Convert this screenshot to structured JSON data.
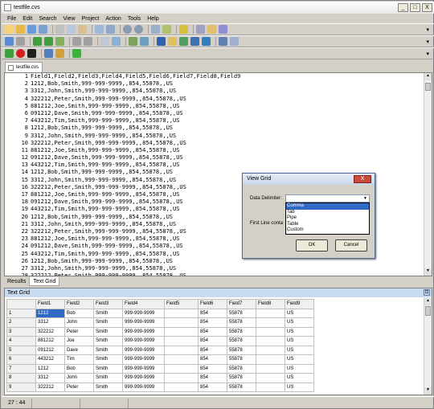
{
  "window": {
    "title": "testfile.cvs",
    "min": "_",
    "max": "□",
    "close": "X"
  },
  "menu": [
    "File",
    "Edit",
    "Search",
    "View",
    "Project",
    "Action",
    "Tools",
    "Help"
  ],
  "file_tab": "testfile.cvs",
  "editor_lines": [
    "Field1,Field2,Field3,Field4,Field5,Field6,Field7,Field8,Field9",
    "1212,Bob,Smith,999-999-9999,,854,55878,,US",
    "3312,John,Smith,999-999-9999,,854,55878,,US",
    "322212,Peter,Smith,999-999-9999,,854,55878,,US",
    "881212,Joe,Smith,999-999-9999,,854,55878,,US",
    "091212,Dave,Smith,999-999-9999,,854,55878,,US",
    "443212,Tim,Smith,999-999-9999,,854,55878,,US",
    "1212,Bob,Smith,999-999-9999,,854,55878,,US",
    "3312,John,Smith,999-999-9999,,854,55878,,US",
    "322212,Peter,Smith,999-999-9999,,854,55878,,US",
    "881212,Joe,Smith,999-999-9999,,854,55878,,US",
    "091212,Dave,Smith,999-999-9999,,854,55878,,US",
    "443212,Tim,Smith,999-999-9999,,854,55878,,US",
    "1212,Bob,Smith,999-999-9999,,854,55878,,US",
    "3312,John,Smith,999-999-9999,,854,55878,,US",
    "322212,Peter,Smith,999-999-9999,,854,55878,,US",
    "881212,Joe,Smith,999-999-9999,,854,55878,,US",
    "091212,Dave,Smith,999-999-9999,,854,55878,,US",
    "443212,Tim,Smith,999-999-9999,,854,55878,,US",
    "1212,Bob,Smith,999-999-9999,,854,55878,,US",
    "3312,John,Smith,999-999-9999,,854,55878,,US",
    "322212,Peter,Smith,999-999-9999,,854,55878,,US",
    "881212,Joe,Smith,999-999-9999,,854,55878,,US",
    "091212,Dave,Smith,999-999-9999,,854,55878,,US",
    "443212,Tim,Smith,999-999-9999,,854,55878,,US",
    "1212,Bob,Smith,999-999-9999,,854,55878,,US",
    "3312,John,Smith,999-999-9999,,854,55878,,US",
    "322212,Peter,Smith,999-999-9999,,854,55878,,US"
  ],
  "bottom_tabs": [
    "Results",
    "Text Grid"
  ],
  "grid_panel": {
    "title": "Text Grid",
    "columns": [
      "Field1",
      "Field2",
      "Field3",
      "Field4",
      "Field5",
      "Field6",
      "Field7",
      "Field8",
      "Field9"
    ],
    "rows": [
      [
        "1",
        "1212",
        "Bob",
        "Smith",
        "999-999-9999",
        "",
        "854",
        "55878",
        "",
        "US"
      ],
      [
        "2",
        "3312",
        "John",
        "Smith",
        "999-999-9999",
        "",
        "854",
        "55878",
        "",
        "US"
      ],
      [
        "3",
        "322212",
        "Peter",
        "Smith",
        "999-999-9999",
        "",
        "854",
        "55878",
        "",
        "US"
      ],
      [
        "4",
        "881212",
        "Joe",
        "Smith",
        "999-999-9999",
        "",
        "854",
        "55878",
        "",
        "US"
      ],
      [
        "5",
        "091212",
        "Dave",
        "Smith",
        "999-999-9999",
        "",
        "854",
        "55878",
        "",
        "US"
      ],
      [
        "6",
        "443212",
        "Tim",
        "Smith",
        "999-999-9999",
        "",
        "854",
        "55878",
        "",
        "US"
      ],
      [
        "7",
        "1212",
        "Bob",
        "Smith",
        "999-999-9999",
        "",
        "854",
        "55878",
        "",
        "US"
      ],
      [
        "8",
        "3312",
        "John",
        "Smith",
        "999-999-9999",
        "",
        "854",
        "55878",
        "",
        "US"
      ],
      [
        "9",
        "322212",
        "Peter",
        "Smith",
        "999-999-9999",
        "",
        "854",
        "55878",
        "",
        "US"
      ]
    ]
  },
  "status": {
    "position": "27 : 44"
  },
  "dialog": {
    "title": "View Grid",
    "close": "X",
    "delimiter_label": "Data Delimiter:",
    "first_line_label": "First Line conta",
    "options": [
      "Comma",
      "Tab",
      "Pipe",
      "Table",
      "Custom"
    ],
    "selected_option": "Comma",
    "ok": "OK",
    "cancel": "Cancel"
  },
  "colors": {
    "selection": "#316ac5",
    "panel_header": "#c8daf0"
  }
}
